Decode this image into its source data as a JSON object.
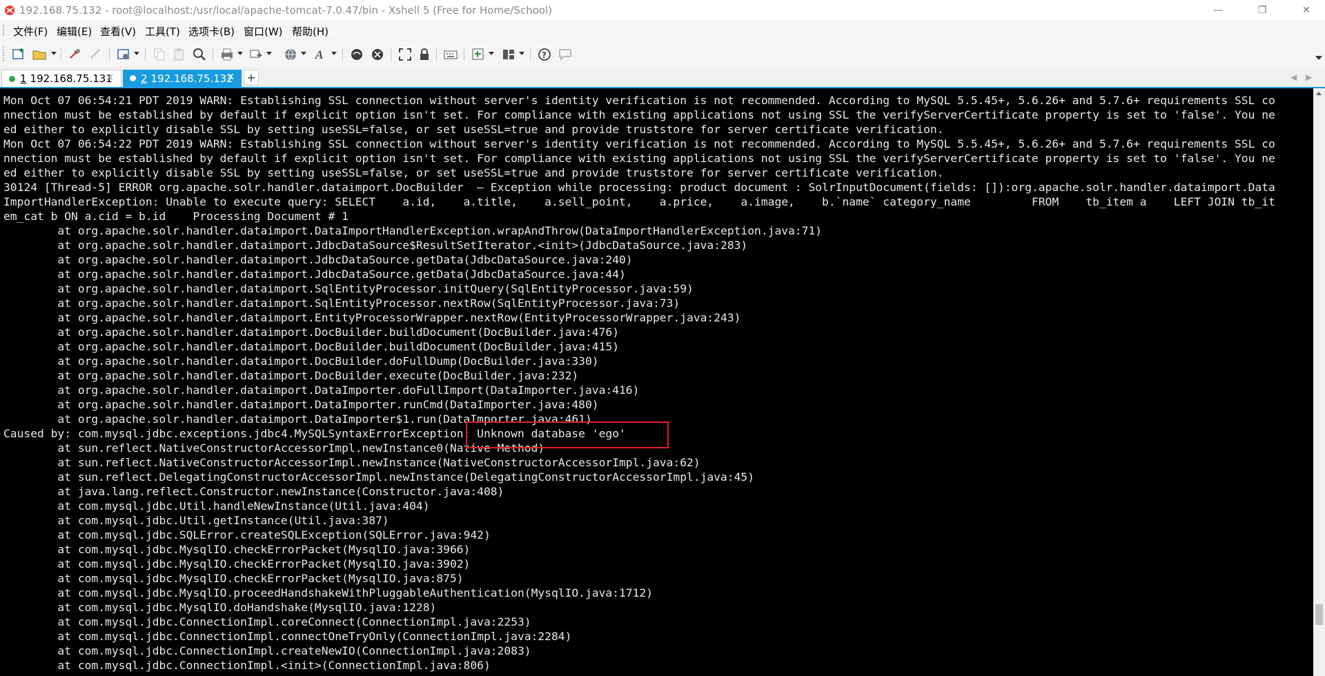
{
  "window": {
    "title": "192.168.75.132 - root@localhost:/usr/local/apache-tomcat-7.0.47/bin - Xshell 5 (Free for Home/School)",
    "app_icon": "xshell-logo-icon",
    "controls": {
      "minimize": "—",
      "maximize": "❐",
      "close": "✕"
    }
  },
  "menu": {
    "items": [
      {
        "label": "文件(F)"
      },
      {
        "label": "编辑(E)"
      },
      {
        "label": "查看(V)"
      },
      {
        "label": "工具(T)"
      },
      {
        "label": "选项卡(B)"
      },
      {
        "label": "窗口(W)"
      },
      {
        "label": "帮助(H)"
      }
    ]
  },
  "toolbar": {
    "buttons": [
      "new-session-icon",
      "open-folder-icon",
      "reconnect-icon",
      "disconnect-icon",
      "properties-icon",
      "copy-icon",
      "paste-icon",
      "find-icon",
      "print-icon",
      "transfer-icon",
      "encoding-globe-icon",
      "font-icon",
      "xftp-icon",
      "xmanager-icon",
      "fullscreen-icon",
      "lock-icon",
      "keyboard-icon",
      "compose-icon",
      "layout-icon",
      "help-icon",
      "comment-icon"
    ]
  },
  "tabs": [
    {
      "number": "1",
      "label": "192.168.75.131",
      "active": false,
      "status_color": "#2ca84a"
    },
    {
      "number": "2",
      "label": "192.168.75.132",
      "active": true,
      "status_color": "#ffffff"
    }
  ],
  "tab_add_label": "+",
  "tab_nav": {
    "prev": "◀",
    "next": "▶"
  },
  "terminal": {
    "lines": [
      "Mon Oct 07 06:54:21 PDT 2019 WARN: Establishing SSL connection without server's identity verification is not recommended. According to MySQL 5.5.45+, 5.6.26+ and 5.7.6+ requirements SSL co",
      "nnection must be established by default if explicit option isn't set. For compliance with existing applications not using SSL the verifyServerCertificate property is set to 'false'. You ne",
      "ed either to explicitly disable SSL by setting useSSL=false, or set useSSL=true and provide truststore for server certificate verification.",
      "Mon Oct 07 06:54:22 PDT 2019 WARN: Establishing SSL connection without server's identity verification is not recommended. According to MySQL 5.5.45+, 5.6.26+ and 5.7.6+ requirements SSL co",
      "nnection must be established by default if explicit option isn't set. For compliance with existing applications not using SSL the verifyServerCertificate property is set to 'false'. You ne",
      "ed either to explicitly disable SSL by setting useSSL=false, or set useSSL=true and provide truststore for server certificate verification.",
      "30124 [Thread-5] ERROR org.apache.solr.handler.dataimport.DocBuilder  – Exception while processing: product document : SolrInputDocument(fields: []):org.apache.solr.handler.dataimport.Data",
      "ImportHandlerException: Unable to execute query: SELECT    a.id,    a.title,    a.sell_point,    a.price,    a.image,    b.`name` category_name         FROM    tb_item a    LEFT JOIN tb_it",
      "em_cat b ON a.cid = b.id    Processing Document # 1",
      "        at org.apache.solr.handler.dataimport.DataImportHandlerException.wrapAndThrow(DataImportHandlerException.java:71)",
      "        at org.apache.solr.handler.dataimport.JdbcDataSource$ResultSetIterator.<init>(JdbcDataSource.java:283)",
      "        at org.apache.solr.handler.dataimport.JdbcDataSource.getData(JdbcDataSource.java:240)",
      "        at org.apache.solr.handler.dataimport.JdbcDataSource.getData(JdbcDataSource.java:44)",
      "        at org.apache.solr.handler.dataimport.SqlEntityProcessor.initQuery(SqlEntityProcessor.java:59)",
      "        at org.apache.solr.handler.dataimport.SqlEntityProcessor.nextRow(SqlEntityProcessor.java:73)",
      "        at org.apache.solr.handler.dataimport.EntityProcessorWrapper.nextRow(EntityProcessorWrapper.java:243)",
      "        at org.apache.solr.handler.dataimport.DocBuilder.buildDocument(DocBuilder.java:476)",
      "        at org.apache.solr.handler.dataimport.DocBuilder.buildDocument(DocBuilder.java:415)",
      "        at org.apache.solr.handler.dataimport.DocBuilder.doFullDump(DocBuilder.java:330)",
      "        at org.apache.solr.handler.dataimport.DocBuilder.execute(DocBuilder.java:232)",
      "        at org.apache.solr.handler.dataimport.DataImporter.doFullImport(DataImporter.java:416)",
      "        at org.apache.solr.handler.dataimport.DataImporter.runCmd(DataImporter.java:480)",
      "        at org.apache.solr.handler.dataimport.DataImporter$1.run(DataImporter.java:461)",
      "Caused by: com.mysql.jdbc.exceptions.jdbc4.MySQLSyntaxErrorException: Unknown database 'ego'",
      "        at sun.reflect.NativeConstructorAccessorImpl.newInstance0(Native Method)",
      "        at sun.reflect.NativeConstructorAccessorImpl.newInstance(NativeConstructorAccessorImpl.java:62)",
      "        at sun.reflect.DelegatingConstructorAccessorImpl.newInstance(DelegatingConstructorAccessorImpl.java:45)",
      "        at java.lang.reflect.Constructor.newInstance(Constructor.java:408)",
      "        at com.mysql.jdbc.Util.handleNewInstance(Util.java:404)",
      "        at com.mysql.jdbc.Util.getInstance(Util.java:387)",
      "        at com.mysql.jdbc.SQLError.createSQLException(SQLError.java:942)",
      "        at com.mysql.jdbc.MysqlIO.checkErrorPacket(MysqlIO.java:3966)",
      "        at com.mysql.jdbc.MysqlIO.checkErrorPacket(MysqlIO.java:3902)",
      "        at com.mysql.jdbc.MysqlIO.checkErrorPacket(MysqlIO.java:875)",
      "        at com.mysql.jdbc.MysqlIO.proceedHandshakeWithPluggableAuthentication(MysqlIO.java:1712)",
      "        at com.mysql.jdbc.MysqlIO.doHandshake(MysqlIO.java:1228)",
      "        at com.mysql.jdbc.ConnectionImpl.coreConnect(ConnectionImpl.java:2253)",
      "        at com.mysql.jdbc.ConnectionImpl.connectOneTryOnly(ConnectionImpl.java:2284)",
      "        at com.mysql.jdbc.ConnectionImpl.createNewIO(ConnectionImpl.java:2083)",
      "        at com.mysql.jdbc.ConnectionImpl.<init>(ConnectionImpl.java:806)"
    ],
    "colors": {
      "background": "#000000",
      "text": "#e8e8e8",
      "highlight_border": "#e02020"
    }
  },
  "colors": {
    "accent": "#1a9be0"
  }
}
